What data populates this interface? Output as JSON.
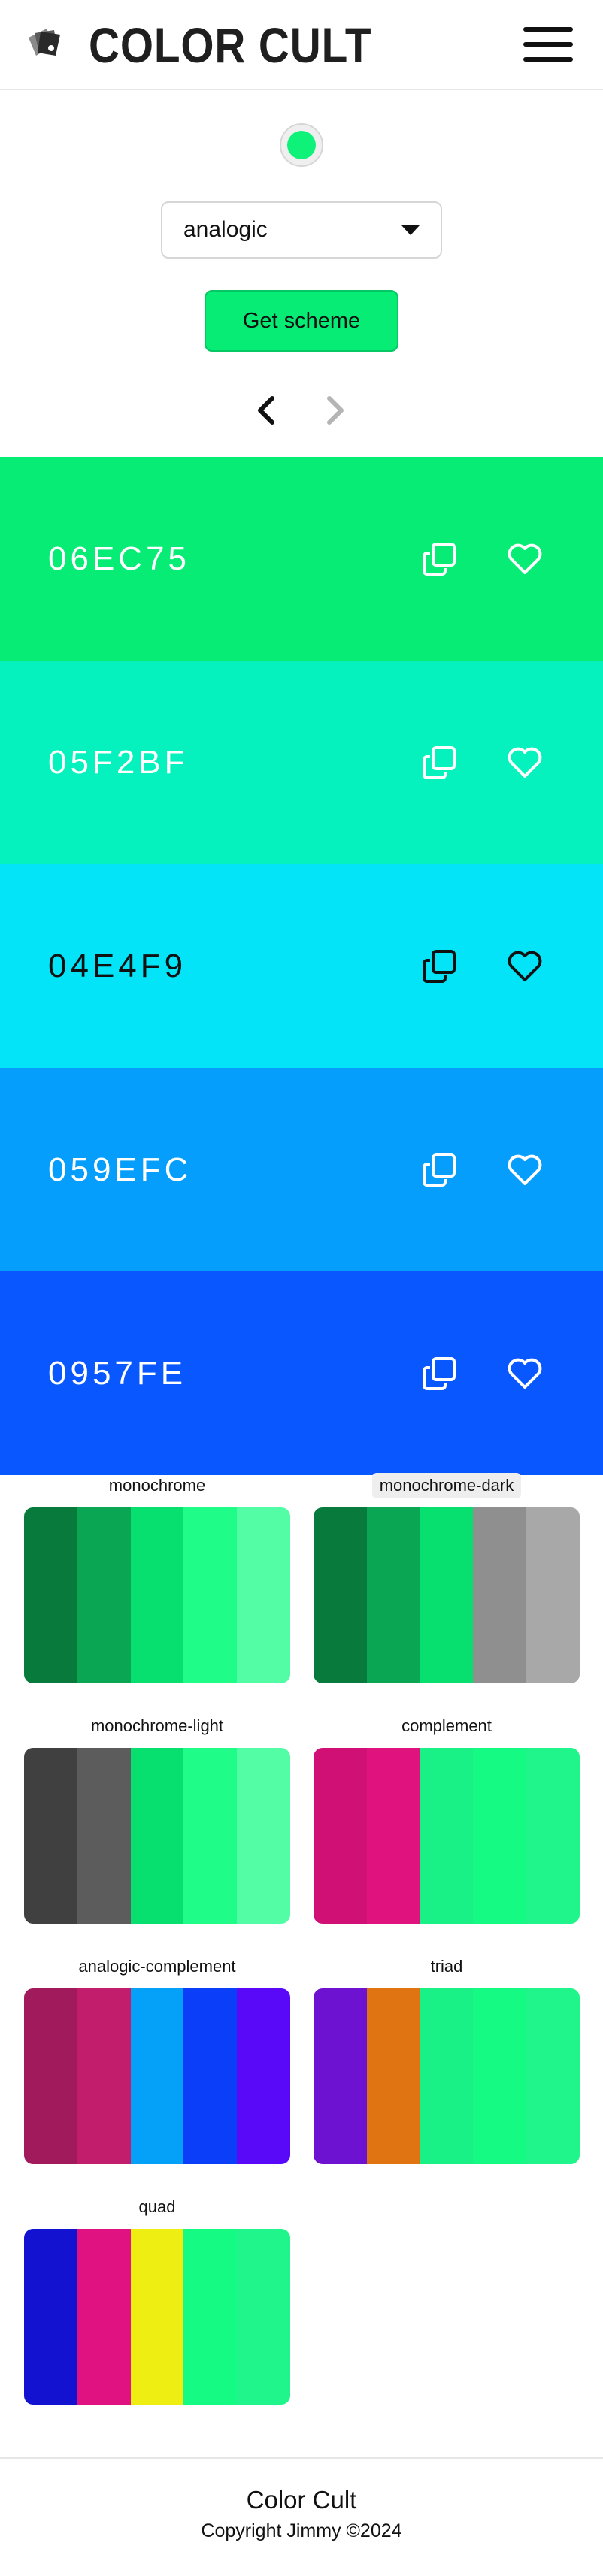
{
  "header": {
    "logo_text": "COLOR CULT",
    "logo_icon": "paint-swatch-icon",
    "menu_icon": "hamburger-menu-icon"
  },
  "controls": {
    "seed_color": "#0EF279",
    "mode_value": "analogic",
    "get_scheme_label": "Get scheme",
    "get_scheme_color": "#06EC75",
    "prev_icon": "chevron-left-icon",
    "next_icon": "chevron-right-icon"
  },
  "swatches": [
    {
      "hex": "06EC75",
      "color": "#06EC75",
      "text_color": "#ffffff"
    },
    {
      "hex": "05F2BF",
      "color": "#05F2BF",
      "text_color": "#ffffff"
    },
    {
      "hex": "04E4F9",
      "color": "#04E4F9",
      "text_color": "#111111"
    },
    {
      "hex": "059EFC",
      "color": "#059EFC",
      "text_color": "#ffffff"
    },
    {
      "hex": "0957FE",
      "color": "#0957FE",
      "text_color": "#ffffff"
    }
  ],
  "swatch_icons": {
    "copy": "copy-icon",
    "favorite": "heart-icon"
  },
  "schemes": [
    {
      "label": "monochrome",
      "active": false,
      "colors": [
        "#077A3C",
        "#0BA654",
        "#07E06F",
        "#1FFC88",
        "#53FDA5"
      ]
    },
    {
      "label": "monochrome-dark",
      "active": true,
      "colors": [
        "#077A3C",
        "#0BA654",
        "#07E06F",
        "#8F8F8F",
        "#A8A8A8"
      ]
    },
    {
      "label": "monochrome-light",
      "active": false,
      "colors": [
        "#404040",
        "#5C5C5C",
        "#07E06F",
        "#1FFC88",
        "#53FDA5"
      ]
    },
    {
      "label": "complement",
      "active": false,
      "colors": [
        "#D01075",
        "#E0137E",
        "#19F086",
        "#14FA83",
        "#1FF58A"
      ]
    },
    {
      "label": "analogic-complement",
      "active": false,
      "colors": [
        "#A11A5C",
        "#C21C6C",
        "#05A0F8",
        "#0A3EF8",
        "#5A08F8"
      ]
    },
    {
      "label": "triad",
      "active": false,
      "colors": [
        "#6D12D0",
        "#E07412",
        "#19F086",
        "#14FA83",
        "#1FF58A"
      ]
    },
    {
      "label": "quad",
      "active": false,
      "colors": [
        "#1212D0",
        "#E01282",
        "#EEEE12",
        "#14FA83",
        "#1FF58A"
      ]
    }
  ],
  "footer": {
    "title": "Color Cult",
    "copyright": "Copyright Jimmy ©2024"
  }
}
